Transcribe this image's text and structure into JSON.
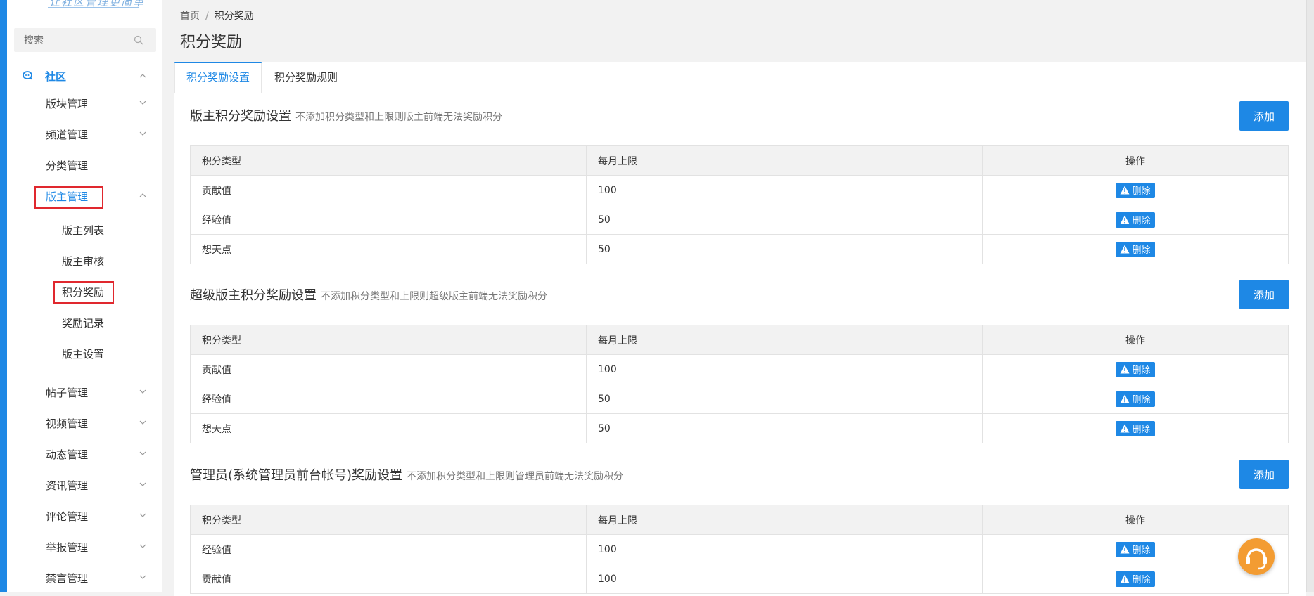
{
  "sidebar": {
    "logo_text": "让社区管理更简单",
    "search": {
      "placeholder": "搜索",
      "value": ""
    },
    "group": {
      "label": "社区"
    },
    "items": [
      {
        "label": "版块管理"
      },
      {
        "label": "频道管理"
      },
      {
        "label": "分类管理"
      },
      {
        "label": "版主管理"
      }
    ],
    "sub_items": [
      {
        "label": "版主列表"
      },
      {
        "label": "版主审核"
      },
      {
        "label": "积分奖励"
      },
      {
        "label": "奖励记录"
      },
      {
        "label": "版主设置"
      }
    ],
    "items_after": [
      {
        "label": "帖子管理"
      },
      {
        "label": "视频管理"
      },
      {
        "label": "动态管理"
      },
      {
        "label": "资讯管理"
      },
      {
        "label": "评论管理"
      },
      {
        "label": "举报管理"
      },
      {
        "label": "禁言管理"
      }
    ]
  },
  "breadcrumb": {
    "home": "首页",
    "separator": "/",
    "current": "积分奖励"
  },
  "page_title": "积分奖励",
  "tabs": [
    {
      "label": "积分奖励设置"
    },
    {
      "label": "积分奖励规则"
    }
  ],
  "sections": [
    {
      "title": "版主积分奖励设置",
      "hint": "不添加积分类型和上限则版主前端无法奖励积分",
      "add_label": "添加",
      "columns": [
        "积分类型",
        "每月上限",
        "操作"
      ],
      "rows": [
        {
          "type": "贡献值",
          "limit": "100",
          "action": "删除"
        },
        {
          "type": "经验值",
          "limit": "50",
          "action": "删除"
        },
        {
          "type": "想天点",
          "limit": "50",
          "action": "删除"
        }
      ]
    },
    {
      "title": "超级版主积分奖励设置",
      "hint": "不添加积分类型和上限则超级版主前端无法奖励积分",
      "add_label": "添加",
      "columns": [
        "积分类型",
        "每月上限",
        "操作"
      ],
      "rows": [
        {
          "type": "贡献值",
          "limit": "100",
          "action": "删除"
        },
        {
          "type": "经验值",
          "limit": "50",
          "action": "删除"
        },
        {
          "type": "想天点",
          "limit": "50",
          "action": "删除"
        }
      ]
    },
    {
      "title": "管理员(系统管理员前台帐号)奖励设置",
      "hint": "不添加积分类型和上限则管理员前端无法奖励积分",
      "add_label": "添加",
      "columns": [
        "积分类型",
        "每月上限",
        "操作"
      ],
      "rows": [
        {
          "type": "经验值",
          "limit": "100",
          "action": "删除"
        },
        {
          "type": "贡献值",
          "limit": "100",
          "action": "删除"
        }
      ]
    }
  ],
  "colors": {
    "accent": "#1e88e5",
    "highlight_border": "#e0282e",
    "support_bubble": "#f39c32"
  },
  "icons": [
    "search-icon",
    "chat-bubbles-icon",
    "chevron-down-icon",
    "chevron-up-icon",
    "warning-icon",
    "headset-icon"
  ]
}
